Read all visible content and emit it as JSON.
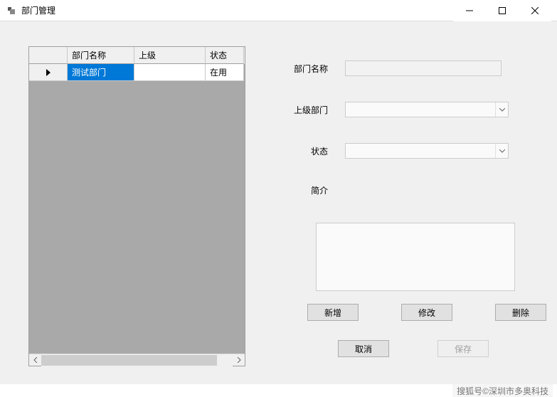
{
  "window": {
    "title": "部门管理"
  },
  "grid": {
    "headers": {
      "name": "部门名称",
      "parent": "上级",
      "status": "状态"
    },
    "rows": [
      {
        "name": "测试部门",
        "parent": "",
        "status": "在用",
        "selected": true
      }
    ]
  },
  "form": {
    "labels": {
      "name": "部门名称",
      "parent": "上级部门",
      "status": "状态",
      "intro": "简介"
    },
    "values": {
      "name": "",
      "parent": "",
      "status": "",
      "intro": ""
    }
  },
  "buttons": {
    "add": "新增",
    "edit": "修改",
    "delete": "删除",
    "cancel": "取消",
    "save": "保存"
  },
  "watermark": "搜狐号©深圳市多奥科技"
}
